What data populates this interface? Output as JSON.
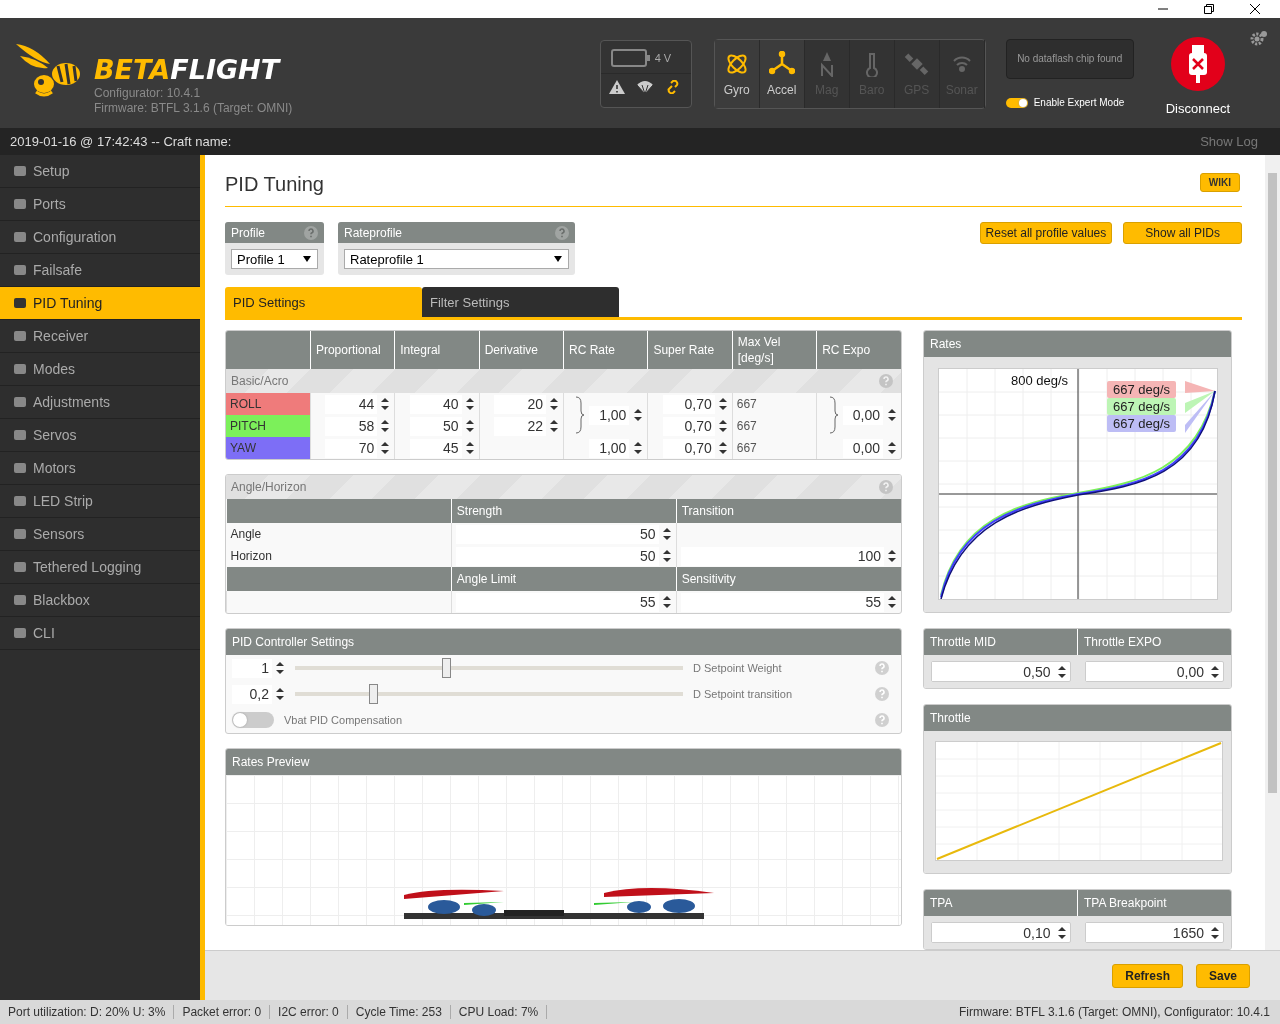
{
  "header": {
    "logo": {
      "accent": "BETA",
      "rest": "FLIGHT"
    },
    "configurator": "Configurator: 10.4.1",
    "firmware": "Firmware: BTFL 3.1.6 (Target: OMNI)",
    "battery": "4 V",
    "sensors": [
      {
        "label": "Gyro",
        "on": true
      },
      {
        "label": "Accel",
        "on": true
      },
      {
        "label": "Mag",
        "on": false
      },
      {
        "label": "Baro",
        "on": false
      },
      {
        "label": "GPS",
        "on": false
      },
      {
        "label": "Sonar",
        "on": false
      }
    ],
    "dataflash": "No dataflash chip found",
    "expert_mode": {
      "label": "Enable Expert Mode",
      "on": true
    },
    "disconnect": "Disconnect"
  },
  "infobar": {
    "text": "2019-01-16 @ 17:42:43 -- Craft name:",
    "show_log": "Show Log"
  },
  "sidebar": {
    "items": [
      {
        "label": "Setup",
        "selected": false
      },
      {
        "label": "Ports",
        "selected": false
      },
      {
        "label": "Configuration",
        "selected": false
      },
      {
        "label": "Failsafe",
        "selected": false
      },
      {
        "label": "PID Tuning",
        "selected": true
      },
      {
        "label": "Receiver",
        "selected": false
      },
      {
        "label": "Modes",
        "selected": false
      },
      {
        "label": "Adjustments",
        "selected": false
      },
      {
        "label": "Servos",
        "selected": false
      },
      {
        "label": "Motors",
        "selected": false
      },
      {
        "label": "LED Strip",
        "selected": false
      },
      {
        "label": "Sensors",
        "selected": false
      },
      {
        "label": "Tethered Logging",
        "selected": false
      },
      {
        "label": "Blackbox",
        "selected": false
      },
      {
        "label": "CLI",
        "selected": false
      }
    ]
  },
  "page": {
    "title": "PID Tuning",
    "wiki": "WIKI",
    "profiles": [
      {
        "label": "Profile",
        "value": "Profile 1"
      },
      {
        "label": "Rateprofile",
        "value": "Rateprofile 1"
      }
    ],
    "buttons": [
      "Reset all profile values",
      "Show all PIDs"
    ],
    "tabs": [
      {
        "label": "PID Settings",
        "selected": true
      },
      {
        "label": "Filter Settings",
        "selected": false
      }
    ],
    "pid_table": {
      "columns": [
        "Proportional",
        "Integral",
        "Derivative",
        "RC Rate",
        "Super Rate",
        "Max Vel [deg/s]",
        "RC Expo"
      ],
      "section": "Basic/Acro",
      "rows": [
        {
          "name": "ROLL",
          "color": "#ef7b7b",
          "p": "44",
          "i": "40",
          "d": "20",
          "rc_rate": "1,00",
          "super_rate": "0,70",
          "max_vel": "667",
          "rc_expo": "0,00"
        },
        {
          "name": "PITCH",
          "color": "#7cf05a",
          "p": "58",
          "i": "50",
          "d": "22",
          "super_rate": "0,70",
          "max_vel": "667"
        },
        {
          "name": "YAW",
          "color": "#7d6ef6",
          "p": "70",
          "i": "45",
          "rc_rate": "1,00",
          "super_rate": "0,70",
          "max_vel": "667",
          "rc_expo": "0,00"
        }
      ]
    },
    "angle_horizon": {
      "title": "Angle/Horizon",
      "columns": [
        "Strength",
        "Transition"
      ],
      "rows": [
        {
          "label": "Angle",
          "strength": "50"
        },
        {
          "label": "Horizon",
          "strength": "50",
          "transition": "100"
        }
      ],
      "limit_columns": [
        "Angle Limit",
        "Sensitivity"
      ],
      "limit_values": [
        "55",
        "55"
      ]
    },
    "pid_controller": {
      "title": "PID Controller Settings",
      "sliders": [
        {
          "value": "1",
          "level": 0.39,
          "label": "D Setpoint Weight"
        },
        {
          "value": "0,2",
          "level": 0.2,
          "label": "D Setpoint transition"
        }
      ],
      "vbat": {
        "label": "Vbat PID Compensation",
        "on": false
      }
    },
    "rates_preview": {
      "title": "Rates Preview"
    },
    "rates": {
      "title": "Rates",
      "max_label": "800 deg/s",
      "labels": [
        {
          "text": "667 deg/s",
          "color": "#f5b5b5"
        },
        {
          "text": "667 deg/s",
          "color": "#bdf5b5"
        },
        {
          "text": "667 deg/s",
          "color": "#bdbdf5"
        }
      ]
    },
    "throttle_settings": {
      "columns": [
        "Throttle MID",
        "Throttle EXPO"
      ],
      "values": [
        "0,50",
        "0,00"
      ]
    },
    "throttle": {
      "title": "Throttle"
    },
    "tpa": {
      "columns": [
        "TPA",
        "TPA Breakpoint"
      ],
      "values": [
        "0,10",
        "1650"
      ]
    },
    "actions": [
      "Refresh",
      "Save"
    ]
  },
  "status_bar": {
    "items": [
      "Port utilization: D: 20% U: 3%",
      "Packet error: 0",
      "I2C error: 0",
      "Cycle Time: 253",
      "CPU Load: 7%"
    ],
    "firmware": "Firmware: BTFL 3.1.6 (Target: OMNI), Configurator: 10.4.1"
  }
}
